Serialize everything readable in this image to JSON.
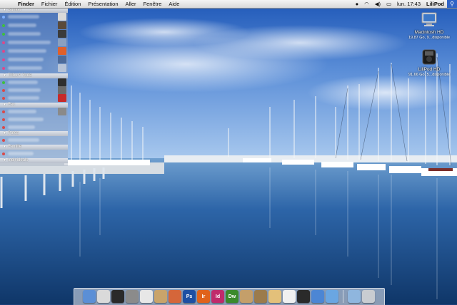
{
  "menubar": {
    "items": [
      "Finder",
      "Fichier",
      "Édition",
      "Présentation",
      "Aller",
      "Fenêtre",
      "Aide"
    ],
    "clock": "lun. 17:43",
    "user": "LiliPod"
  },
  "contacts": {
    "groups": [
      "Bunker",
      "Tribu A Yoda",
      "Fac",
      "Potes",
      "Famille",
      "Individuals"
    ]
  },
  "desktop": {
    "drive1": {
      "name": "Macintosh HD",
      "info": "19,87 Go, 9...disponible"
    },
    "drive2": {
      "name": "LiliPod HD",
      "info": "91,66 Go, 5...disponible"
    }
  },
  "dock": {
    "apps": [
      {
        "icon": "finder-icon",
        "label": "",
        "color": "#5b8fd6"
      },
      {
        "icon": "ichat-icon",
        "label": "",
        "color": "#dadada"
      },
      {
        "icon": "dashboard-icon",
        "label": "",
        "color": "#2a2a2a"
      },
      {
        "icon": "photo-booth-icon",
        "label": "",
        "color": "#8b8b8b"
      },
      {
        "icon": "mail-icon",
        "label": "",
        "color": "#e7e7e7"
      },
      {
        "icon": "address-book-icon",
        "label": "",
        "color": "#c9a46b"
      },
      {
        "icon": "preview-icon",
        "label": "",
        "color": "#d5663a"
      },
      {
        "icon": "photoshop-icon",
        "label": "Ps",
        "color": "#1d4fa3"
      },
      {
        "icon": "illustrator-icon",
        "label": "Ir",
        "color": "#e0621b"
      },
      {
        "icon": "indesign-icon",
        "label": "Id",
        "color": "#c02a6b"
      },
      {
        "icon": "dreamweaver-icon",
        "label": "Dw",
        "color": "#3a8a2b"
      },
      {
        "icon": "iphoto-icon",
        "label": "",
        "color": "#c49f6a"
      },
      {
        "icon": "preview2-icon",
        "label": "",
        "color": "#9b7b4c"
      },
      {
        "icon": "box-icon",
        "label": "",
        "color": "#e3c07a"
      },
      {
        "icon": "adium-icon",
        "label": "",
        "color": "#f0f0f0"
      },
      {
        "icon": "camino-icon",
        "label": "",
        "color": "#2a2a2a"
      },
      {
        "icon": "safari-icon",
        "label": "",
        "color": "#4c86d4"
      },
      {
        "icon": "itunes-icon",
        "label": "",
        "color": "#6aa6e2"
      },
      {
        "icon": "documents-icon",
        "label": "",
        "color": "#8fb6de"
      },
      {
        "icon": "trash-icon",
        "label": "",
        "color": "#c9ccd1"
      }
    ]
  }
}
